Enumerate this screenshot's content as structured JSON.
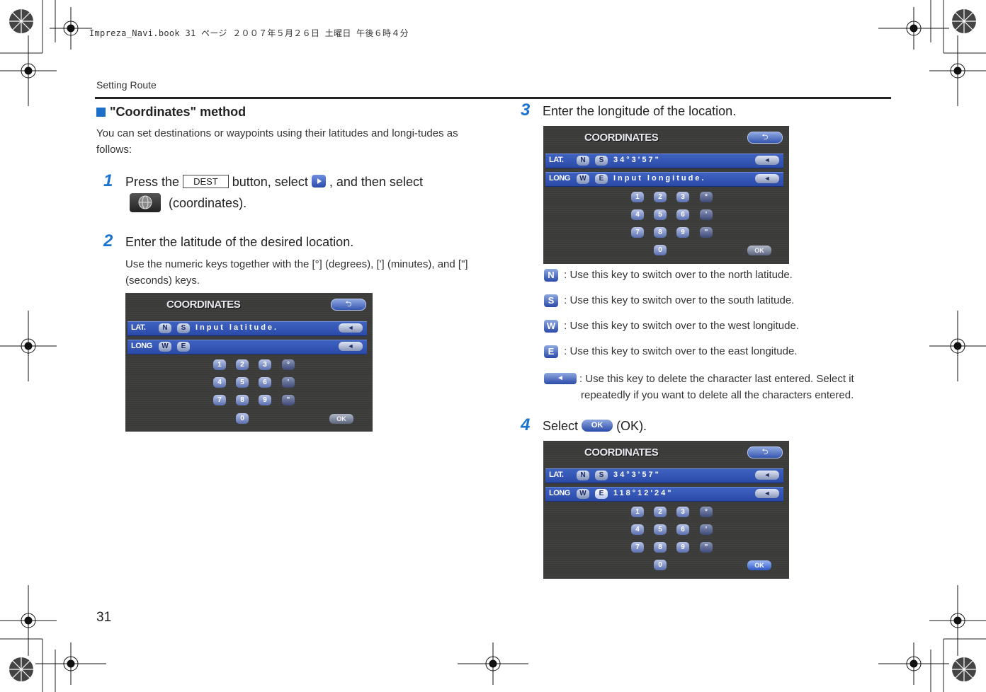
{
  "header": {
    "print_info": "Impreza_Navi.book  31 ページ  ２００７年５月２６日  土曜日  午後６時４分",
    "section": "Setting Route"
  },
  "page_number": "31",
  "title": "\"Coordinates\" method",
  "intro": "You can set destinations or waypoints using their latitudes and longi-tudes as follows:",
  "steps": [
    {
      "num": "1",
      "pre": "Press the",
      "button": "DEST",
      "mid": "button, select",
      "mid2": ", and then select",
      "post": "(coordinates)."
    },
    {
      "num": "2",
      "text": "Enter the latitude of the desired location.",
      "desc": "Use the numeric keys together with the [°] (degrees), ['] (minutes), and [\"] (seconds) keys."
    },
    {
      "num": "3",
      "text": "Enter the longitude of the location."
    },
    {
      "num": "4",
      "pre": "Select",
      "post": "(OK)."
    }
  ],
  "screen": {
    "title": "COORDINATES",
    "lat_label": "LAT.",
    "long_label": "LONG",
    "keys": {
      "n": "N",
      "s": "S",
      "w": "W",
      "e": "E",
      "ok": "OK"
    },
    "numbers": [
      "1",
      "2",
      "3",
      "4",
      "5",
      "6",
      "7",
      "8",
      "9",
      "0"
    ],
    "symbols": [
      "°",
      "'",
      "\""
    ],
    "screen1": {
      "lat": "Input latitude.",
      "long": ""
    },
    "screen2": {
      "lat": "34°3'57\"",
      "long": "Input longitude."
    },
    "screen3": {
      "lat": "34°3'57\"",
      "long": "118°12'24\""
    }
  },
  "key_descriptions": [
    {
      "key": "N",
      "text": ": Use this key to switch over to the north latitude."
    },
    {
      "key": "S",
      "text": ": Use this key to switch over to the south latitude."
    },
    {
      "key": "W",
      "text": ": Use this key to switch over to the west longitude."
    },
    {
      "key": "E",
      "text": ": Use this key to switch over to the east longitude."
    },
    {
      "key": "◄",
      "text": ": Use this key to delete the character last entered. Select it repeatedly if you want to delete all the characters entered."
    }
  ],
  "colors": {
    "accent": "#1b73d1",
    "screen_bg": "#3b3c3a",
    "row_bg": "#3356b8"
  }
}
